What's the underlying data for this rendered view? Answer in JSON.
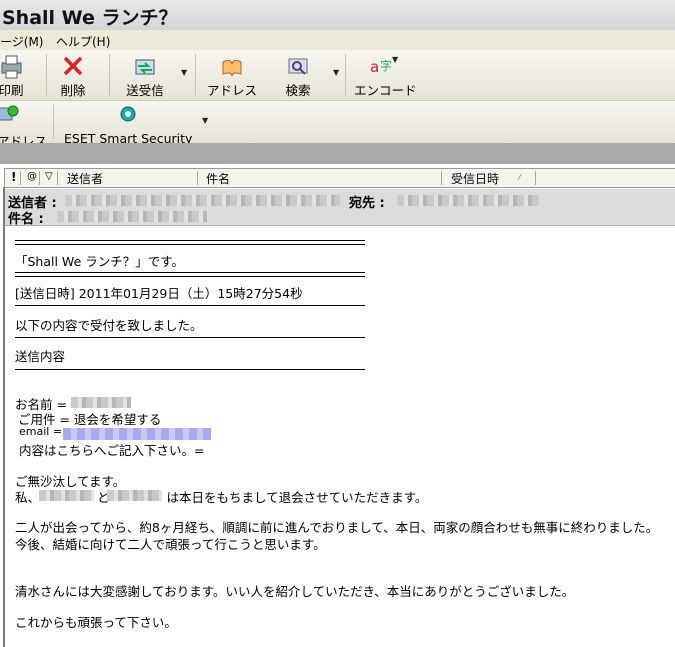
{
  "window": {
    "title": "Shall We ランチ？"
  },
  "menu": {
    "items": [
      "ージ(M)",
      "ヘルプ(H)"
    ]
  },
  "toolbar": {
    "print": "印刷",
    "delete": "削除",
    "send_receive": "送受信",
    "address": "アドレス",
    "search": "検索",
    "encoding": "エンコード"
  },
  "toolbar2": {
    "address": "アドレス",
    "eset": "ESET Smart Security"
  },
  "columns": {
    "sender": "送信者",
    "subject": "件名",
    "received": "受信日時"
  },
  "header": {
    "from_label": "送信者 :",
    "to_label": "宛先 :",
    "subject_label": "件名 :"
  },
  "body": {
    "rule_double": "==================================================",
    "rule_single": "------------------------------------------------------------",
    "title_line": "「Shall We ランチ？」です。",
    "sent_datetime": "[送信日時] 2011年01月29日（土）15時27分54秒",
    "accepted": "以下の内容で受付を致しました。",
    "content_label": "送信内容",
    "name_label": "お名前 =",
    "subject_field": "ご用件 = 退会を希望する",
    "email_label": "email =",
    "fill_in": "内容はこちらへご記入下さい。=",
    "greeting": "ご無沙汰してます。",
    "me_prefix": "私、",
    "me_and": "と",
    "me_suffix": "は本日をもちまして退会させていただきます。",
    "para1_line1": "二人が出会ってから、約8ヶ月経ち、順調に前に進んでおりまして、本日、両家の顔合わせも無事に終わりました。",
    "para1_line2": "今後、結婚に向けて二人で頑張って行こうと思います。",
    "thanks": "清水さんには大変感謝しております。いい人を紹介していただき、本当にありがとうございました。",
    "closing": "これからも頑張って下さい。"
  }
}
